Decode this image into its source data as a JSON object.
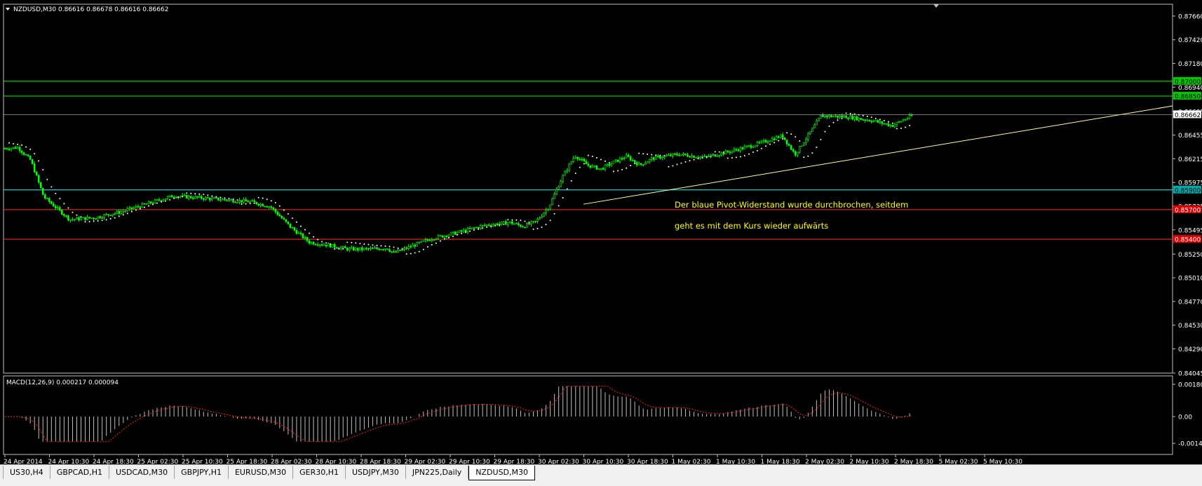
{
  "main_chart": {
    "symbol_line": "NZDUSD,M30  0.86616 0.86678 0.86616 0.86662",
    "price_axis": [
      "0.87660",
      "0.87420",
      "0.87180",
      "0.86940",
      "0.86695",
      "0.86455",
      "0.86215",
      "0.85975",
      "0.85735",
      "0.85495",
      "0.85250",
      "0.85010",
      "0.84770",
      "0.84530",
      "0.84290",
      "0.84045"
    ],
    "price_min": 0.84045,
    "price_max": 0.8778,
    "last_price_label": "0.86662",
    "levels": [
      {
        "label": "0.87000",
        "price": 0.87,
        "color": "#00ff00",
        "label_bg": "#00c800",
        "label_fg": "#000000"
      },
      {
        "label": "0.86850",
        "price": 0.8685,
        "color": "#00ff00",
        "label_bg": "#00c800",
        "label_fg": "#000000"
      },
      {
        "label": "0.85900",
        "price": 0.859,
        "color": "#00ffff",
        "label_bg": "#00aaaa",
        "label_fg": "#000000"
      },
      {
        "label": "0.85700",
        "price": 0.857,
        "color": "#ff3030",
        "label_bg": "#e00000",
        "label_fg": "#ffffff"
      },
      {
        "label": "0.85400",
        "price": 0.854,
        "color": "#ff3030",
        "label_bg": "#e00000",
        "label_fg": "#ffffff"
      }
    ],
    "annotation_lines": [
      "Der blaue Pivot-Widerstand wurde durchbrochen, seitdem",
      "geht es mit dem Kurs wieder aufwärts"
    ],
    "colors": {
      "bull": "#00ff00",
      "bear": "#00ff00",
      "psar": "#ffffff",
      "trendline": "#ffff99",
      "annotation": "#ffff00"
    }
  },
  "macd_panel": {
    "title": "MACD(12,26,9) 0.000217 0.000094",
    "axis": [
      "0.001806",
      "0.00",
      "-0.001498"
    ],
    "signal_color": "#ff2020",
    "hist_color": "#c0c0c0"
  },
  "time_axis": [
    "24 Apr 2014",
    "24 Apr 10:30",
    "24 Apr 18:30",
    "25 Apr 02:30",
    "25 Apr 10:30",
    "25 Apr 18:30",
    "28 Apr 02:30",
    "28 Apr 10:30",
    "28 Apr 18:30",
    "29 Apr 02:30",
    "29 Apr 10:30",
    "29 Apr 18:30",
    "30 Apr 02:30",
    "30 Apr 10:30",
    "30 Apr 18:30",
    "1 May 02:30",
    "1 May 10:30",
    "1 May 18:30",
    "2 May 02:30",
    "2 May 10:30",
    "2 May 18:30",
    "5 May 02:30",
    "5 May 10:30"
  ],
  "tabs": [
    {
      "label": "US30,H4",
      "active": false
    },
    {
      "label": "GBPCAD,H1",
      "active": false
    },
    {
      "label": "USDCAD,M30",
      "active": false
    },
    {
      "label": "GBPJPY,H1",
      "active": false
    },
    {
      "label": "EURUSD,M30",
      "active": false
    },
    {
      "label": "GER30,H1",
      "active": false
    },
    {
      "label": "USDJPY,M30",
      "active": false
    },
    {
      "label": "JPN225,Daily",
      "active": false
    },
    {
      "label": "NZDUSD,M30",
      "active": true
    }
  ]
}
